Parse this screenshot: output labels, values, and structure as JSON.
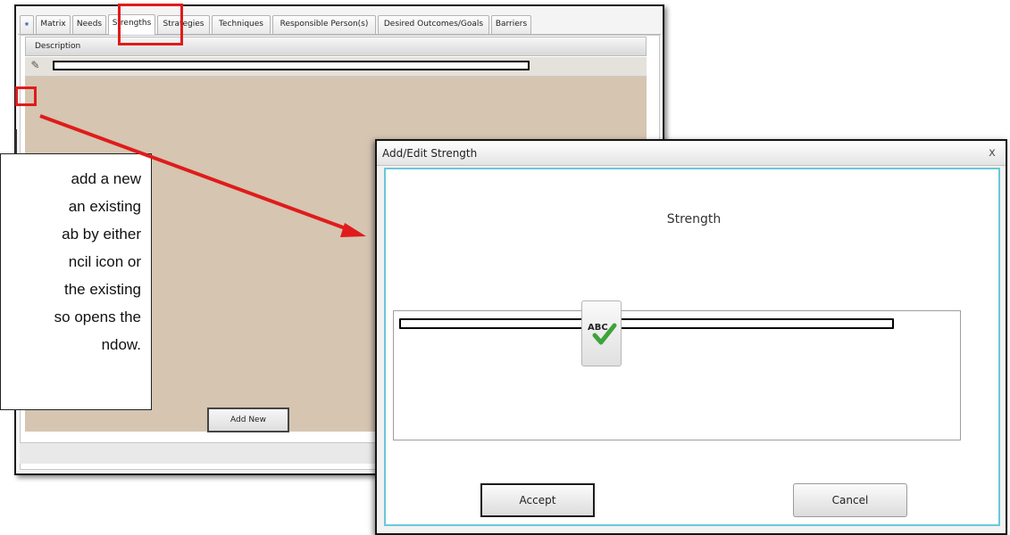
{
  "back_window": {
    "tabs": [
      {
        "label": "⁕",
        "icon": "globe-icon"
      },
      {
        "label": "Matrix"
      },
      {
        "label": "Needs"
      },
      {
        "label": "Strengths",
        "active": true
      },
      {
        "label": "Strategies"
      },
      {
        "label": "Techniques"
      },
      {
        "label": "Responsible Person(s)"
      },
      {
        "label": "Desired Outcomes/Goals"
      },
      {
        "label": "Barriers"
      }
    ],
    "grid": {
      "columns": [
        "Description"
      ],
      "rows": [
        {
          "description": "",
          "edit_icon": "pencil-icon"
        }
      ]
    },
    "add_new_label": "Add New",
    "pencil_glyph": "✎"
  },
  "callout": {
    "lines": [
      "add a new",
      "an   existing",
      "ab  by  either",
      "ncil   icon   or",
      "the   existing",
      "so opens the",
      "ndow."
    ]
  },
  "dialog": {
    "title": "Add/Edit Strength",
    "close_glyph": "x",
    "heading": "Strength",
    "textarea_value": "",
    "spellcheck_label": "ABC",
    "accept_label": "Accept",
    "cancel_label": "Cancel"
  },
  "colors": {
    "highlight": "#e01b1b",
    "grid_body": "#d5c5b1",
    "dialog_border": "#6bc7d9",
    "spellcheck_check": "#3fa33a"
  }
}
